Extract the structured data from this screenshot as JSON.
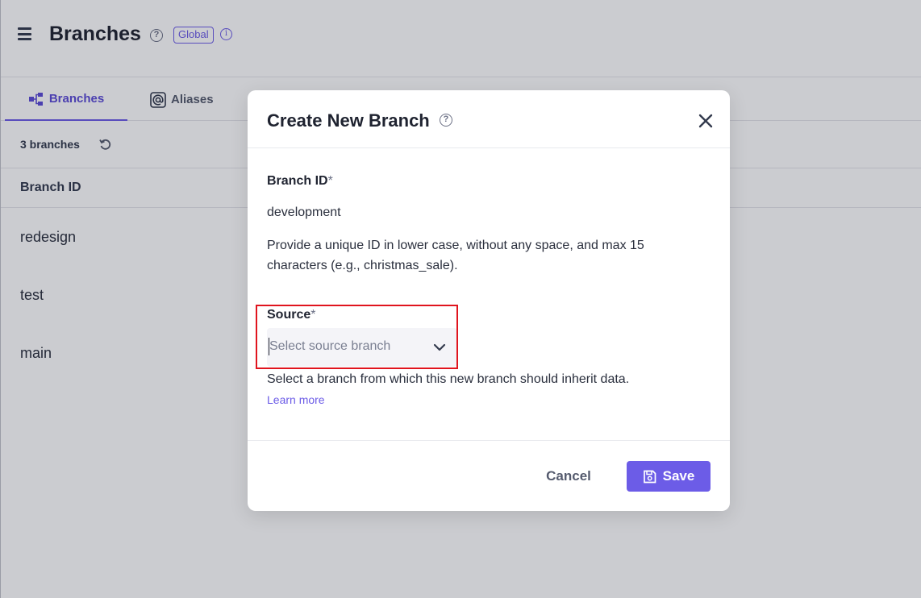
{
  "header": {
    "title": "Branches",
    "help_symbol": "?",
    "scope_badge": "Global",
    "info_symbol": "i"
  },
  "tabs": [
    {
      "label": "Branches",
      "icon": "branches-icon",
      "active": true
    },
    {
      "label": "Aliases",
      "icon": "at-sign-icon",
      "active": false
    }
  ],
  "list": {
    "count_label": "3 branches",
    "column_header": "Branch ID",
    "rows": [
      "redesign",
      "test",
      "main"
    ]
  },
  "modal": {
    "title": "Create New Branch",
    "help_symbol": "?",
    "branch_id": {
      "label": "Branch ID",
      "required_marker": "*",
      "value": "development",
      "helper": "Provide a unique ID in lower case, without any space, and max 15 characters (e.g., christmas_sale)."
    },
    "source": {
      "label": "Source",
      "required_marker": "*",
      "placeholder": "Select source branch",
      "helper": "Select a branch from which this new branch should inherit data.",
      "link": "Learn more"
    },
    "cancel_label": "Cancel",
    "save_label": "Save"
  },
  "colors": {
    "accent": "#6c5ce7",
    "highlight": "#e0141e",
    "overlay": "rgba(20,22,40,0.22)"
  }
}
